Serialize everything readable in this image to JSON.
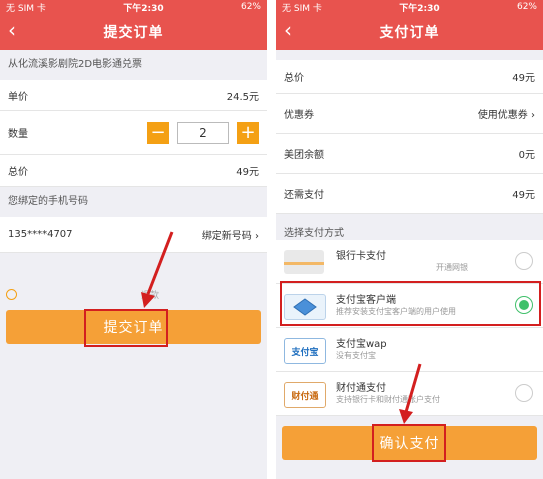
{
  "status": {
    "carrier": "无 SIM 卡",
    "time": "下午2:30",
    "battery": "62%"
  },
  "left": {
    "nav_title": "提交订单",
    "product": "从化流溪影剧院2D电影通兑票",
    "unit_price_label": "单价",
    "unit_price": "24.5元",
    "qty_label": "数量",
    "qty": "2",
    "total_label": "总价",
    "total": "49元",
    "phone_section": "您绑定的手机号码",
    "phone": "135****4707",
    "bind_new": "绑定新号码",
    "refund": "退款",
    "submit": "提交订单"
  },
  "right": {
    "nav_title": "支付订单",
    "total_label": "总价",
    "total": "49元",
    "coupon_label": "优惠券",
    "coupon_action": "使用优惠券",
    "balance_label": "美团余额",
    "balance": "0元",
    "due_label": "还需支付",
    "due": "49元",
    "method_section": "选择支付方式",
    "methods": [
      {
        "title": "银行卡支付",
        "sub": "开通网银",
        "logo": "",
        "selected": false
      },
      {
        "title": "支付宝客户端",
        "sub": "推荐安装支付宝客户端的用户使用",
        "logo": "",
        "selected": true
      },
      {
        "title": "支付宝wap",
        "sub": "没有支付宝",
        "logo": "支付宝",
        "selected": false
      },
      {
        "title": "财付通支付",
        "sub": "支持银行卡和财付通账户支付",
        "logo": "财付通",
        "selected": false
      }
    ],
    "confirm": "确认支付"
  },
  "colors": {
    "nav": "#e8534e",
    "button": "#f5a037",
    "stepper": "#f4a014",
    "highlight": "#d31f1f",
    "radio_on": "#3fc06a"
  }
}
